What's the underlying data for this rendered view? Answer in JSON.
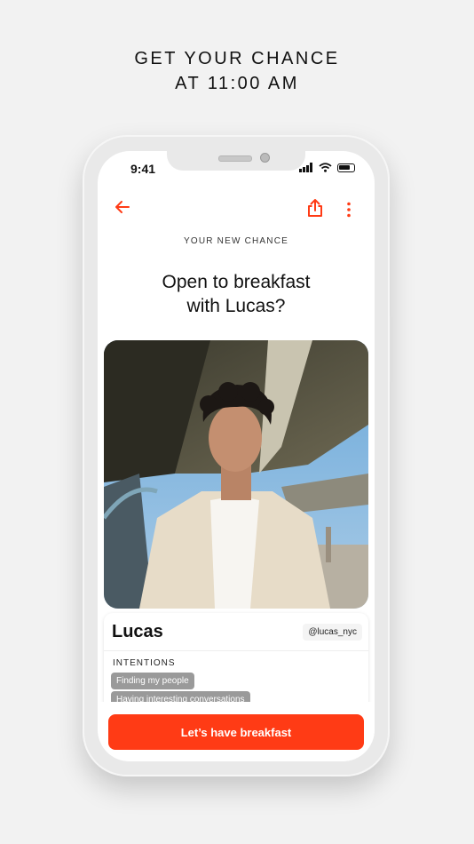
{
  "promo": {
    "line1": "GET YOUR CHANCE",
    "line2": "AT 11:00 AM"
  },
  "status_bar": {
    "time": "9:41",
    "icons": [
      "signal-icon",
      "wifi-icon",
      "battery-icon"
    ]
  },
  "top_nav": {
    "back_icon": "arrow-left-icon",
    "share_icon": "share-icon",
    "more_icon": "more-vertical-icon"
  },
  "screen": {
    "eyebrow": "YOUR NEW CHANCE",
    "title_line1": "Open to breakfast",
    "title_line2": "with Lucas?"
  },
  "profile": {
    "name": "Lucas",
    "handle": "@lucas_nyc",
    "intentions_label": "INTENTIONS",
    "intentions": [
      "Finding my people",
      "Having interesting conversations"
    ]
  },
  "cta": {
    "label": "Let’s have breakfast"
  },
  "colors": {
    "accent": "#ff3b15",
    "background": "#f2f2f2",
    "chip": "#9a9a9a"
  }
}
